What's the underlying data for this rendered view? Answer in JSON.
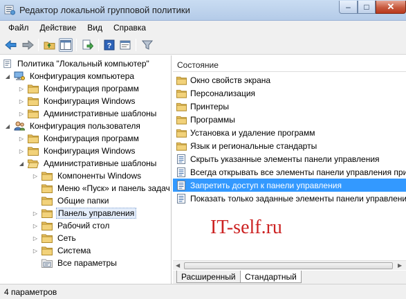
{
  "window": {
    "title": "Редактор локальной групповой политики"
  },
  "window_buttons": {
    "minimize": "–",
    "maximize": "□",
    "close": "✕"
  },
  "menu": [
    {
      "label": "Файл"
    },
    {
      "label": "Действие"
    },
    {
      "label": "Вид"
    },
    {
      "label": "Справка"
    }
  ],
  "toolbar": {
    "buttons": [
      "back-arrow-icon",
      "forward-arrow-icon",
      "up-folder-icon",
      "show-hide-tree-icon",
      "export-list-icon",
      "help-icon",
      "properties-icon",
      "filter-icon"
    ]
  },
  "tree": {
    "root": "Политика \"Локальный компьютер\"",
    "computer_config": {
      "label": "Конфигурация компьютера",
      "children": [
        "Конфигурация программ",
        "Конфигурация Windows",
        "Административные шаблоны"
      ]
    },
    "user_config": {
      "label": "Конфигурация пользователя",
      "children": [
        "Конфигурация программ",
        "Конфигурация Windows",
        "Административные шаблоны"
      ]
    },
    "admin_templates_children": [
      "Компоненты Windows",
      "Меню «Пуск» и панель задач",
      "Общие папки",
      "Панель управления",
      "Рабочий стол",
      "Сеть",
      "Система",
      "Все параметры"
    ]
  },
  "content": {
    "column_header": "Состояние",
    "items": [
      {
        "label": "Окно свойств экрана",
        "type": "folder"
      },
      {
        "label": "Персонализация",
        "type": "folder"
      },
      {
        "label": "Принтеры",
        "type": "folder"
      },
      {
        "label": "Программы",
        "type": "folder"
      },
      {
        "label": "Установка и удаление программ",
        "type": "folder"
      },
      {
        "label": "Язык и региональные стандарты",
        "type": "folder"
      },
      {
        "label": "Скрыть указанные элементы панели управления",
        "type": "setting"
      },
      {
        "label": "Всегда открывать все элементы панели управления при д",
        "type": "setting"
      },
      {
        "label": "Запретить доступ к панели управления",
        "type": "setting",
        "selected": true
      },
      {
        "label": "Показать только заданные элементы панели управления",
        "type": "setting"
      }
    ],
    "watermark": "IT-self.ru"
  },
  "tabs": [
    {
      "label": "Расширенный"
    },
    {
      "label": "Стандартный",
      "active": true
    }
  ],
  "status": {
    "text": "4 параметров"
  },
  "colors": {
    "selection": "#3399ff",
    "watermark": "#cc2222",
    "folder": "#e8c060"
  }
}
